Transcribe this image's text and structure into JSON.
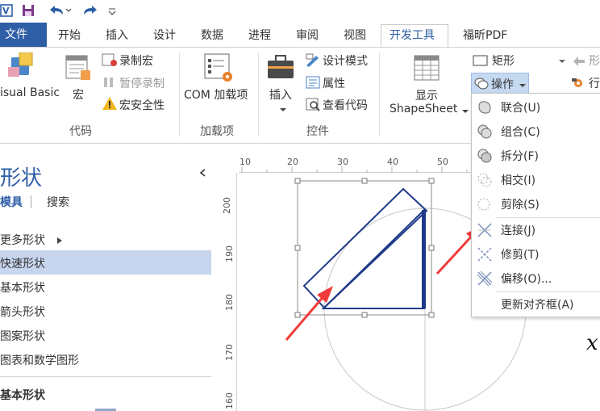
{
  "qat": {
    "icons": [
      "visio-icon",
      "save-icon",
      "undo-icon",
      "redo-icon",
      "customize-icon"
    ]
  },
  "tabs": {
    "file": "文件",
    "items": [
      "开始",
      "插入",
      "设计",
      "数据",
      "进程",
      "审阅",
      "视图",
      "开发工具",
      "福昕PDF"
    ],
    "active": "开发工具"
  },
  "ribbon": {
    "code_group": {
      "visual_basic": "isual Basic",
      "macros": "宏",
      "record_macro": "录制宏",
      "pause_recording": "暂停录制",
      "macro_security": "宏安全性",
      "label": "代码"
    },
    "addins_group": {
      "com_addins": "COM 加载项",
      "label": "加载项"
    },
    "controls_group": {
      "insert": "插入",
      "design_mode": "设计模式",
      "properties": "属性",
      "view_code": "查看代码",
      "label": "控件"
    },
    "shapesheet_group": {
      "show_line1": "显示",
      "show_line2": "ShapeSheet"
    },
    "shape_design": {
      "rectangle": "矩形",
      "operations": "操作",
      "shape_partial": "形",
      "row_partial": "行"
    }
  },
  "operations_menu": {
    "items": [
      {
        "label": "联合(U)",
        "icon": "union-icon"
      },
      {
        "label": "组合(C)",
        "icon": "combine-icon"
      },
      {
        "label": "拆分(F)",
        "icon": "fragment-icon"
      },
      {
        "label": "相交(I)",
        "icon": "intersect-icon"
      },
      {
        "label": "剪除(S)",
        "icon": "subtract-icon"
      },
      {
        "label": "连接(J)",
        "icon": "join-icon"
      },
      {
        "label": "修剪(T)",
        "icon": "trim-icon"
      },
      {
        "label": "偏移(O)...",
        "icon": "offset-icon"
      },
      {
        "label": "更新对齐框(A)",
        "icon": ""
      }
    ]
  },
  "shapes_panel": {
    "title": "形状",
    "tabs": [
      "模具",
      "搜索"
    ],
    "more_shapes": "更多形状",
    "items": [
      "快速形状",
      "基本形状",
      "箭头形状",
      "图案形状",
      "图表和数学图形"
    ],
    "selected": "快速形状",
    "section_title": "基本形状"
  },
  "ruler": {
    "h_ticks": [
      "10",
      "20",
      "30",
      "40",
      "50"
    ],
    "v_ticks": [
      "200",
      "190",
      "180",
      "170",
      "160"
    ]
  },
  "canvas": {
    "partial_text": "x"
  },
  "colors": {
    "file_tab": "#2e5ea6",
    "selected_item": "#c7d5ef",
    "shape_stroke": "#1f3a8a",
    "arrow": "#ef3b3b",
    "highlight_btn": "#c5d9f1"
  }
}
